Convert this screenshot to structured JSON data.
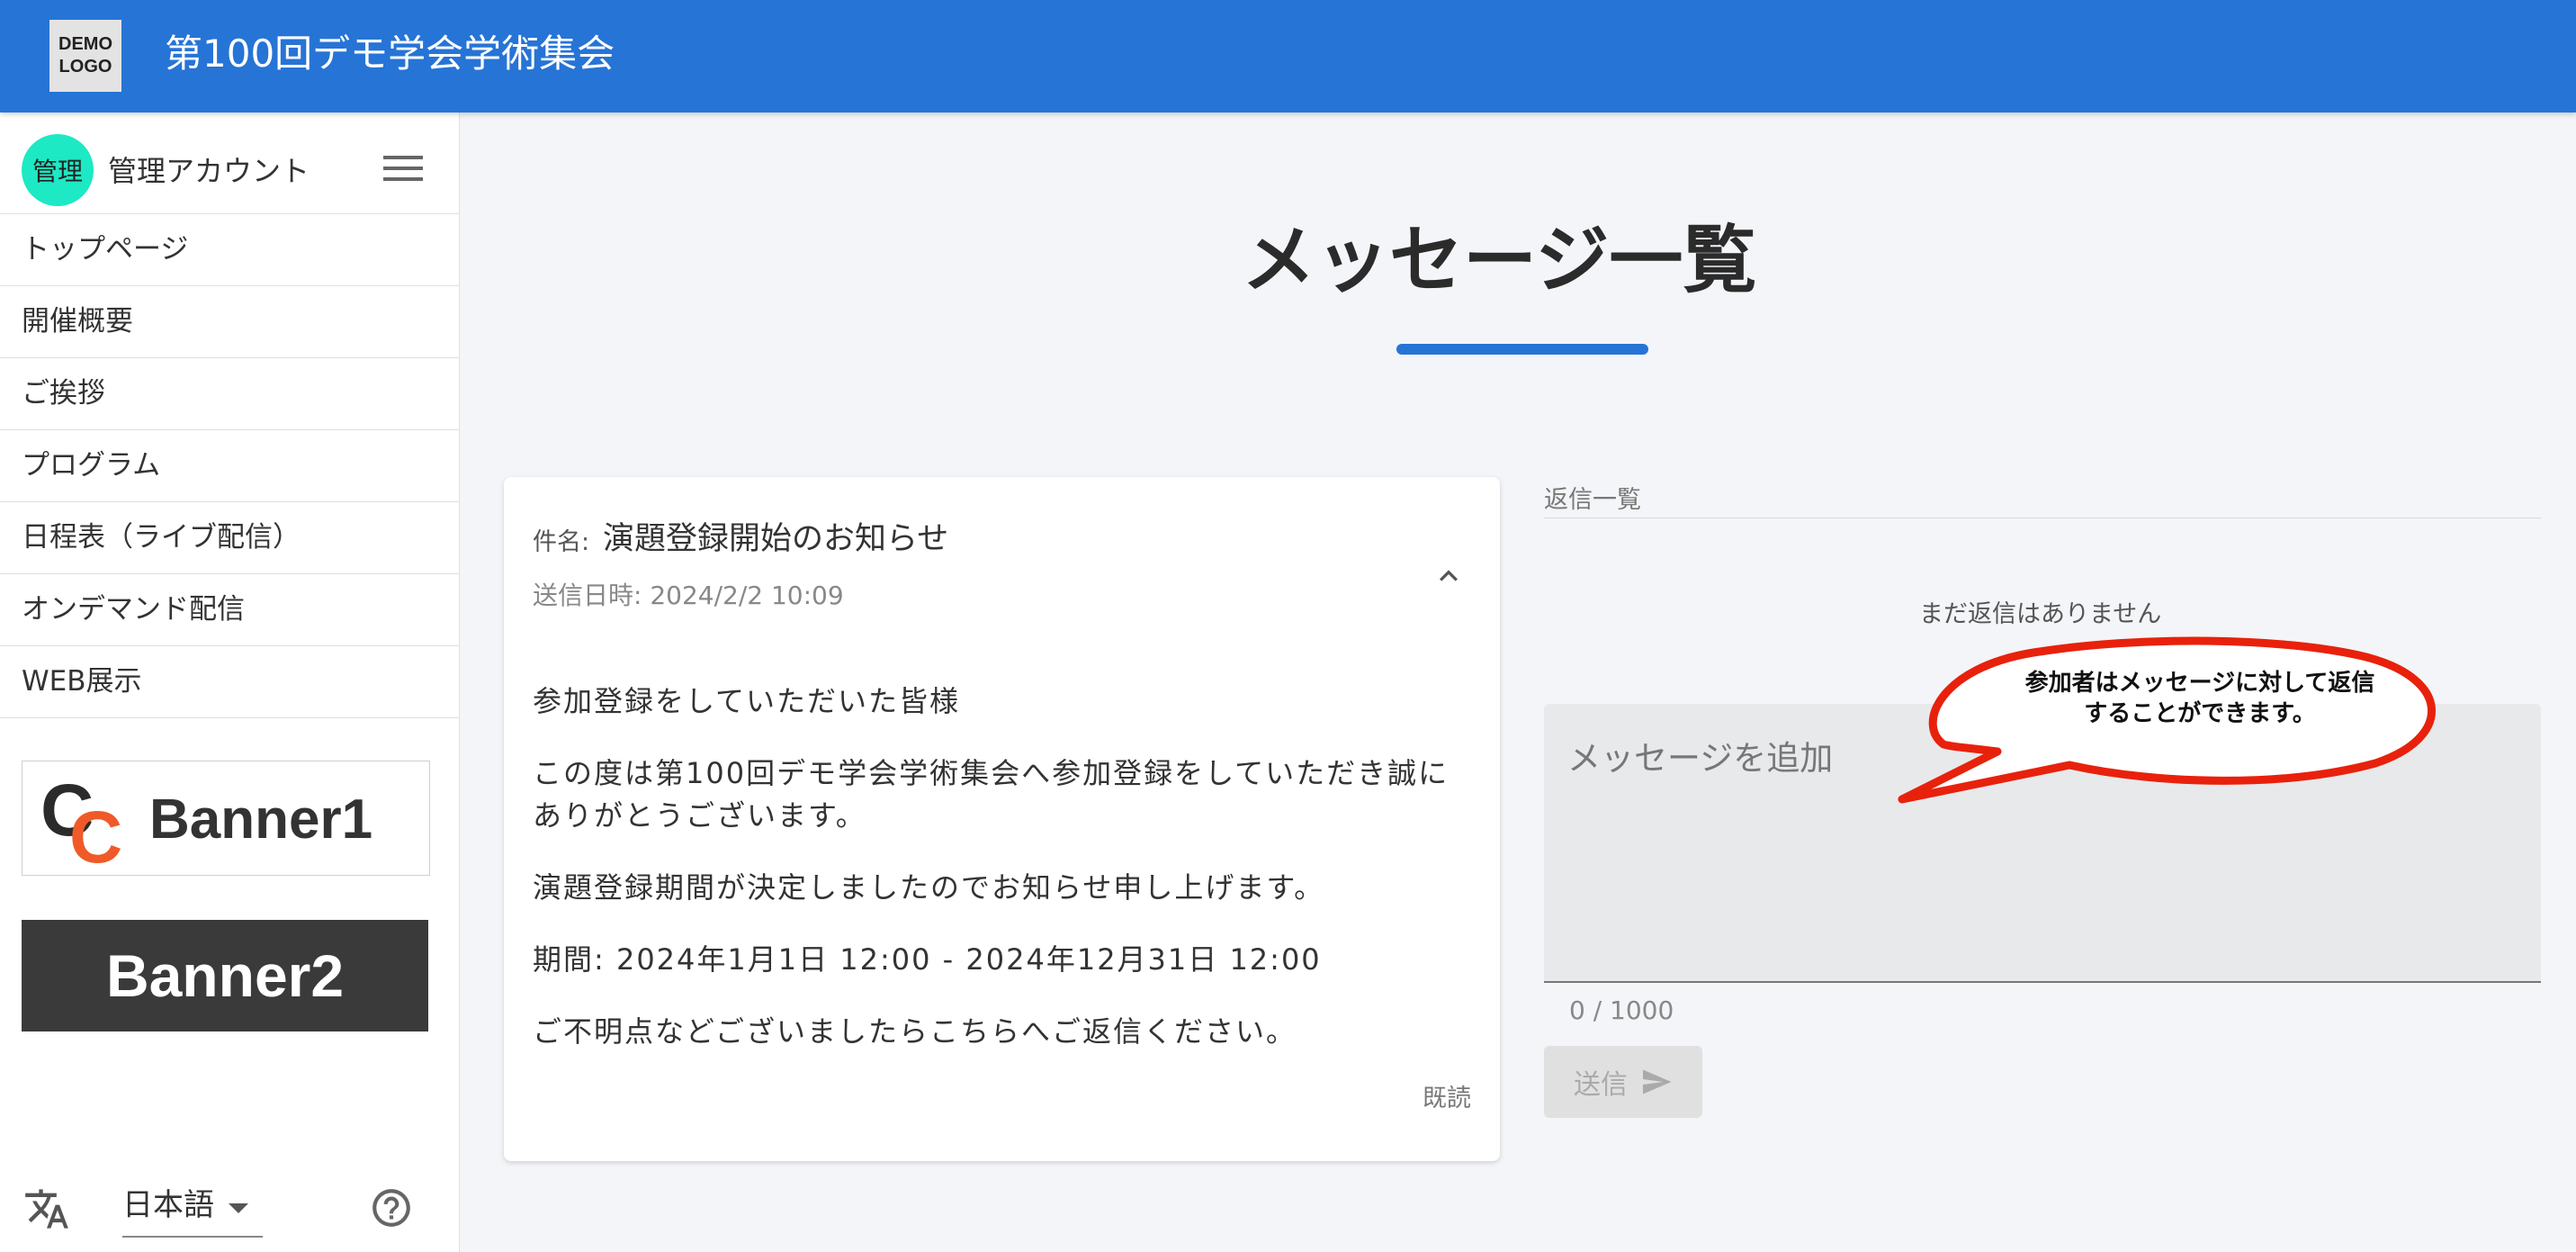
{
  "header": {
    "logo_line1": "DEMO",
    "logo_line2": "LOGO",
    "site_title": "第100回デモ学会学術集会",
    "bg_color": "#2674d6"
  },
  "sidebar": {
    "avatar_text": "管理",
    "account_name": "管理アカウント",
    "menu_icon": "hamburger-icon",
    "items": [
      {
        "label": "トップページ"
      },
      {
        "label": "開催概要"
      },
      {
        "label": "ご挨拶"
      },
      {
        "label": "プログラム"
      },
      {
        "label": "日程表（ライブ配信）"
      },
      {
        "label": "オンデマンド配信"
      },
      {
        "label": "WEB展示"
      }
    ],
    "banner1": {
      "text": "Banner1",
      "logo_letters": "CC",
      "accent": "#f05a28"
    },
    "banner2": {
      "text": "Banner2"
    },
    "language": {
      "selected": "日本語",
      "icon": "translate-icon"
    },
    "help_icon": "help-circle-icon"
  },
  "main": {
    "page_title": "メッセージ一覧",
    "message": {
      "subject_label": "件名:",
      "subject": "演題登録開始のお知らせ",
      "sent_at": "送信日時: 2024/2/2 10:09",
      "body": [
        "参加登録をしていただいた皆様",
        "この度は第100回デモ学会学術集会へ参加登録をしていただき誠にありがとうございます。",
        "演題登録期間が決定しましたのでお知らせ申し上げます。",
        "期間: 2024年1月1日 12:00 - 2024年12月31日 12:00",
        "ご不明点などございましたらこちらへご返信ください。"
      ],
      "read_status": "既読"
    },
    "replies": {
      "label": "返信一覧",
      "empty_text": "まだ返信はありません",
      "input_placeholder": "メッセージを追加",
      "counter": "0 / 1000",
      "send_label": "送信"
    },
    "callout": {
      "line1": "参加者はメッセージに対して返信",
      "line2": "することができます。",
      "border_color": "#e8210c"
    }
  }
}
